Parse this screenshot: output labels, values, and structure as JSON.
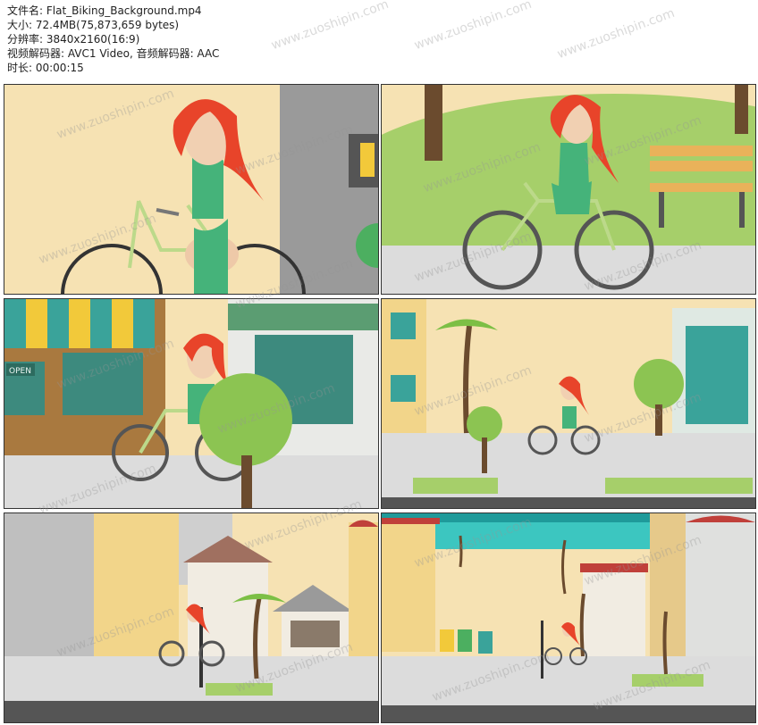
{
  "meta": {
    "filename": "文件名: Flat_Biking_Background.mp4",
    "size": "大小: 72.4MB(75,873,659 bytes)",
    "resolution": "分辨率: 3840x2160(16:9)",
    "codec": "视频解码器: AVC1 Video, 音频解码器: AAC",
    "duration": "时长: 00:00:15"
  },
  "frames": [
    {
      "name": "frame-1",
      "scene": "street closeup"
    },
    {
      "name": "frame-2",
      "scene": "park with bench"
    },
    {
      "name": "frame-3",
      "scene": "shopfront"
    },
    {
      "name": "frame-4",
      "scene": "palm street"
    },
    {
      "name": "frame-5",
      "scene": "town houses"
    },
    {
      "name": "frame-6",
      "scene": "seaside town"
    }
  ],
  "shop_sign": "OPEN",
  "watermark": "www.zuoshipin.com",
  "colors": {
    "sand": "#f6e2b3",
    "grass": "#a6cf6a",
    "road": "#dcdcdc",
    "green": "#45b37a",
    "hair": "#e8442a",
    "teal": "#3aa39a"
  }
}
